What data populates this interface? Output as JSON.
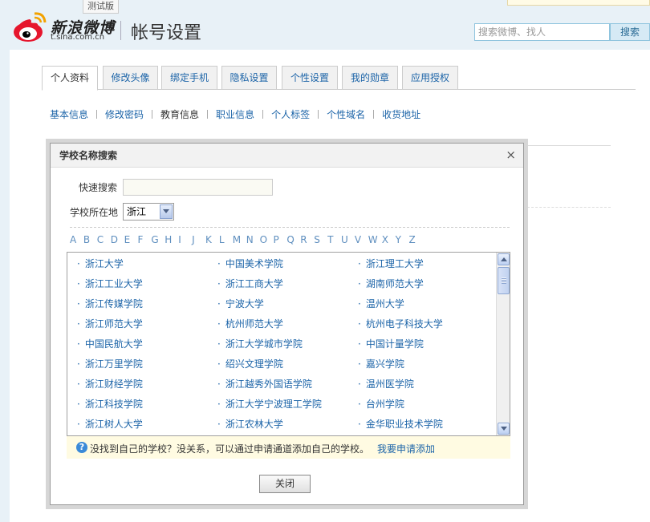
{
  "header": {
    "logo_text": "新浪微博",
    "logo_url_text": "t.sina.com.cn",
    "test_badge": "测试版",
    "title": "帐号设置",
    "search_placeholder": "搜索微博、找人",
    "search_button": "搜索"
  },
  "tabs": [
    {
      "label": "个人资料",
      "active": true
    },
    {
      "label": "修改头像"
    },
    {
      "label": "绑定手机"
    },
    {
      "label": "隐私设置"
    },
    {
      "label": "个性设置"
    },
    {
      "label": "我的勋章"
    },
    {
      "label": "应用授权"
    }
  ],
  "subnav": [
    {
      "label": "基本信息"
    },
    {
      "label": "修改密码"
    },
    {
      "label": "教育信息",
      "current": true
    },
    {
      "label": "职业信息"
    },
    {
      "label": "个人标签"
    },
    {
      "label": "个性域名"
    },
    {
      "label": "收货地址"
    }
  ],
  "dialog": {
    "title": "学校名称搜索",
    "close_icon": "×",
    "quick_search_label": "快速搜索",
    "quick_search_value": "",
    "location_label": "学校所在地",
    "location_value": "浙江",
    "letters": [
      "A",
      "B",
      "C",
      "D",
      "E",
      "F",
      "G",
      "H",
      "I",
      "J",
      "K",
      "L",
      "M",
      "N",
      "O",
      "P",
      "Q",
      "R",
      "S",
      "T",
      "U",
      "V",
      "W",
      "X",
      "Y",
      "Z"
    ],
    "schools": [
      [
        "浙江大学",
        "中国美术学院",
        "浙江理工大学"
      ],
      [
        "浙江工业大学",
        "浙江工商大学",
        "湖南师范大学"
      ],
      [
        "浙江传媒学院",
        "宁波大学",
        "温州大学"
      ],
      [
        "浙江师范大学",
        "杭州师范大学",
        "杭州电子科技大学"
      ],
      [
        "中国民航大学",
        "浙江大学城市学院",
        "中国计量学院"
      ],
      [
        "浙江万里学院",
        "绍兴文理学院",
        "嘉兴学院"
      ],
      [
        "浙江财经学院",
        "浙江越秀外国语学院",
        "温州医学院"
      ],
      [
        "浙江科技学院",
        "浙江大学宁波理工学院",
        "台州学院"
      ],
      [
        "浙江树人大学",
        "浙江农林大学",
        "金华职业技术学院"
      ]
    ],
    "notice_icon": "?",
    "notice_text": "没找到自己的学校？没关系，可以通过申请通道添加自己的学校。",
    "notice_link": "我要申请添加",
    "close_button": "关闭"
  },
  "colors": {
    "link": "#1c64a8",
    "page_bg": "#e8f1f7",
    "notice_bg": "#fffbe2"
  }
}
